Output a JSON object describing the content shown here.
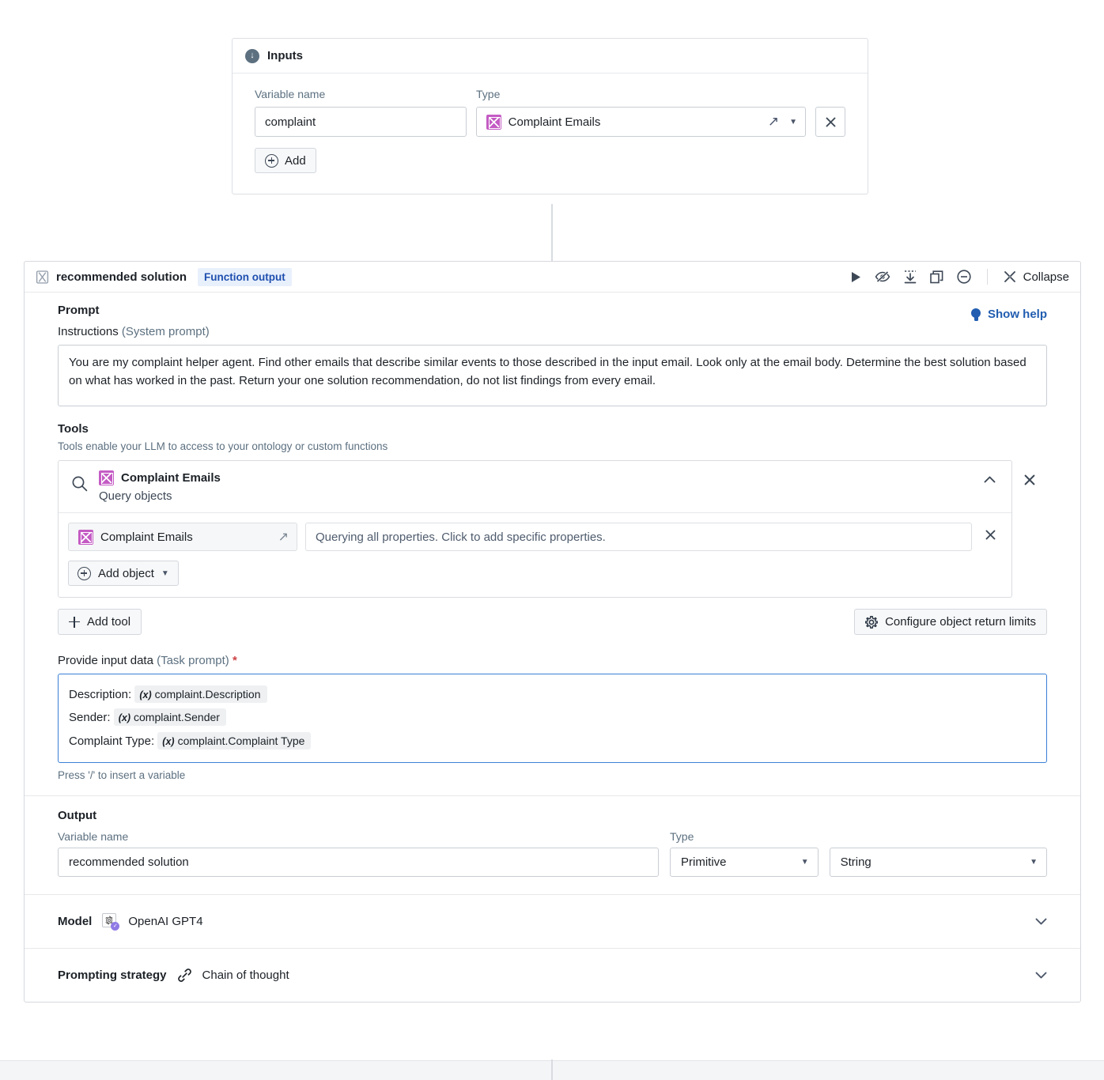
{
  "inputs_card": {
    "title": "Inputs",
    "icon": "download-circle-icon",
    "labels": {
      "variable_name": "Variable name",
      "type": "Type"
    },
    "rows": [
      {
        "variable_name": "complaint",
        "type_label": "Complaint Emails",
        "type_icon": "object-type-icon",
        "open_icon": "external-link-icon",
        "dropdown_icon": "chevron-down-icon",
        "remove_icon": "close-icon"
      }
    ],
    "add_label": "Add"
  },
  "panel": {
    "title": "recommended solution",
    "title_icon": "hourglass-icon",
    "badge": "Function output",
    "toolbar": {
      "run": "run-icon",
      "hide": "eye-off-icon",
      "import": "import-icon",
      "duplicate": "duplicate-icon",
      "remove": "minus-circle-icon",
      "collapse_label": "Collapse",
      "collapse_icon": "collapse-icon"
    },
    "prompt": {
      "heading": "Prompt",
      "show_help": "Show help",
      "show_help_icon": "lightbulb-icon",
      "instructions_label": "Instructions",
      "instructions_sub": "(System prompt)",
      "instructions_value": "You are my complaint helper agent. Find other emails that describe similar events to those described in the input email. Look only at the email body. Determine the best solution based on what has worked in the past. Return your one solution recommendation, do not list findings from every email."
    },
    "tools": {
      "heading": "Tools",
      "hint": "Tools enable your LLM to access to your ontology or custom functions",
      "items": [
        {
          "search_icon": "search-icon",
          "name": "Complaint Emails",
          "name_icon": "object-type-icon",
          "subtitle": "Query objects",
          "collapse_icon": "chevron-up-icon",
          "remove_icon": "close-icon",
          "object": {
            "label": "Complaint Emails",
            "icon": "object-type-icon",
            "open_icon": "external-link-icon",
            "properties_placeholder": "Querying all properties. Click to add specific properties.",
            "remove_icon": "close-icon"
          },
          "add_object_label": "Add object",
          "add_object_icon": "plus-circle-icon",
          "add_object_caret": "chevron-down-icon"
        }
      ],
      "add_tool_label": "Add tool",
      "add_tool_icon": "plus-icon",
      "configure_limits_label": "Configure object return limits",
      "configure_limits_icon": "gear-icon"
    },
    "task_prompt": {
      "label": "Provide input data",
      "sub": "(Task prompt)",
      "required_marker": "*",
      "lines": [
        {
          "prefix": "Description:",
          "variable": "complaint.Description",
          "var_icon": "(x)"
        },
        {
          "prefix": "Sender:",
          "variable": "complaint.Sender",
          "var_icon": "(x)"
        },
        {
          "prefix": "Complaint Type:",
          "variable": "complaint.Complaint Type",
          "var_icon": "(x)"
        }
      ],
      "hint": "Press '/' to insert a variable"
    },
    "output": {
      "heading": "Output",
      "variable_name_label": "Variable name",
      "variable_name_value": "recommended solution",
      "type_label": "Type",
      "type_primitive": "Primitive",
      "type_string": "String",
      "caret_icon": "chevron-down-icon"
    },
    "model": {
      "label": "Model",
      "value": "OpenAI GPT4",
      "icon": "openai-icon",
      "badge_icon": "check-icon",
      "expand_icon": "chevron-down-icon"
    },
    "prompting_strategy": {
      "label": "Prompting strategy",
      "value": "Chain of thought",
      "icon": "link-icon",
      "expand_icon": "chevron-down-icon"
    }
  },
  "colors": {
    "accent_blue": "#215db0",
    "badge_bg": "#e8f0fc",
    "object_purple": "#c45bc4",
    "focus_border": "#3a7fd5",
    "required_red": "#cd4246"
  }
}
